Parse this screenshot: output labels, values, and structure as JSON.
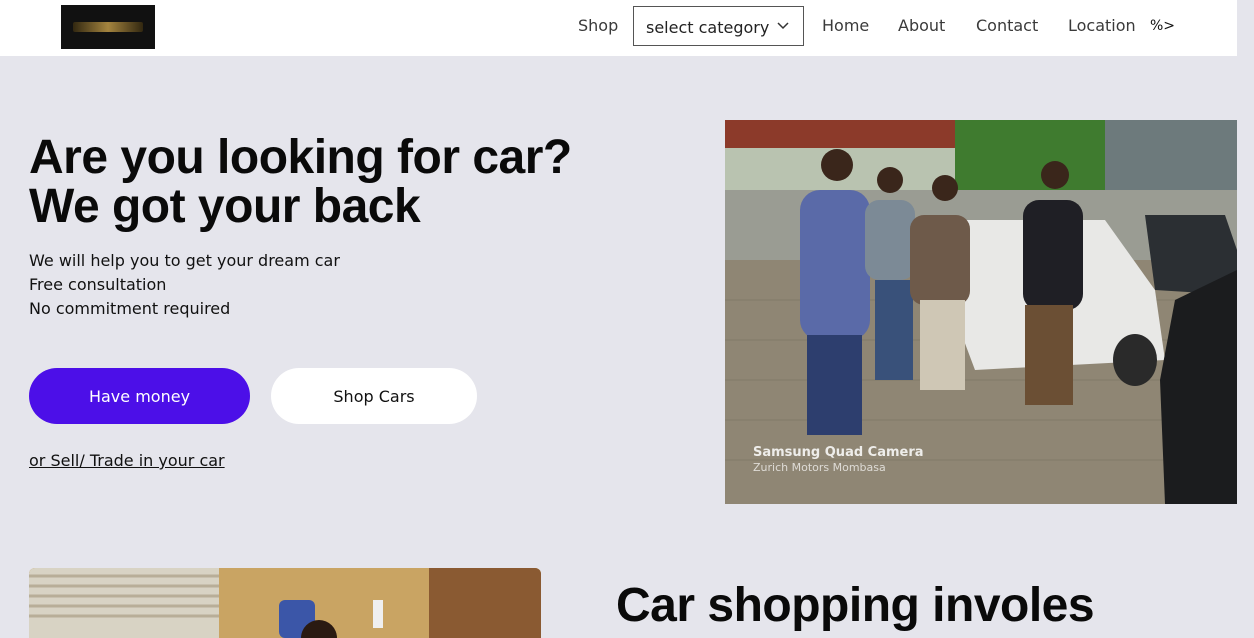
{
  "nav": {
    "logo_alt": "logo",
    "shop": "Shop",
    "category_select": "select category",
    "home": "Home",
    "about": "About",
    "contact": "Contact",
    "location": "Location",
    "stray": "%>"
  },
  "hero": {
    "title_line1": "Are you looking for car?",
    "title_line2": "We got your back",
    "sub1": "We will help you to get your dream car",
    "sub2": "Free consultation",
    "sub3": "No commitment required",
    "btn_money": "Have money",
    "btn_shop": "Shop Cars",
    "sell_link": "or Sell/ Trade in your car",
    "photo_caption": "Samsung Quad Camera",
    "photo_caption2": "Zurich Motors Mombasa"
  },
  "section2": {
    "title": "Car shopping involes"
  },
  "colors": {
    "accent": "#4c0fe8",
    "background": "#e5e5ec",
    "nav_bg": "#ffffff"
  }
}
